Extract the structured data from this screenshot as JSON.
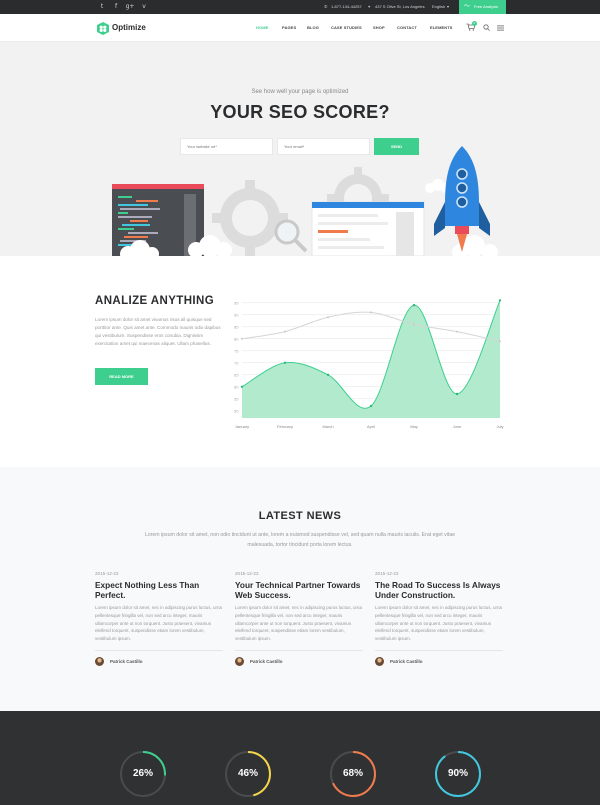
{
  "topbar": {
    "social": [
      "twitter-icon",
      "facebook-icon",
      "google-plus-icon",
      "vimeo-icon"
    ],
    "social_glyphs": [
      "t",
      "f",
      "g+",
      "v"
    ],
    "phone": "1-877-134-44257",
    "address": "437 S Olive St, Los Angeles",
    "language": "English",
    "free_analysis": "Free Analysis"
  },
  "header": {
    "logo": "Optimize",
    "nav": [
      "HOME",
      "PAGES",
      "BLOG",
      "CASE STUDIES",
      "SHOP",
      "CONTACT",
      "ELEMENTS"
    ],
    "cart_count": "0"
  },
  "hero": {
    "subtitle": "See how well your page is optimized",
    "title": "YOUR SEO SCORE?",
    "website_placeholder": "Your website url*",
    "email_placeholder": "Your email*",
    "send": "SEND"
  },
  "analyze": {
    "title": "ANALIZE ANYTHING",
    "text": "Lorem ipsum dolor sit amet vivamus risus all quisque sed porttitor ante. Quis amet ante. Commodo mauris odio dapibus qui vestibulum. Suspendisse eros conubia. Dignissim exercitation amet qui maecenas aliquet. Ullam phasellus.",
    "read_more": "READ MORE"
  },
  "chart_data": {
    "type": "area",
    "categories": [
      "January",
      "February",
      "March",
      "April",
      "May",
      "June",
      "July"
    ],
    "y_ticks": [
      50,
      55,
      60,
      65,
      70,
      75,
      80,
      85,
      90,
      95
    ],
    "ylim": [
      47,
      97
    ],
    "series": [
      {
        "values": [
          80,
          83,
          89,
          91,
          86,
          83,
          79
        ]
      },
      {
        "values": [
          60,
          70,
          65,
          52,
          94,
          57,
          96
        ]
      }
    ],
    "grid": true
  },
  "news": {
    "title": "LATEST NEWS",
    "intro": "Lorem ipsum dolor sit amet, non odio tincidunt ut ante, lorem a euismod suspendisse vel, sed quam nulla mauris iaculis. Erat eget vitae malesuada, tortor tincidunt porta lorem lectus.",
    "posts": [
      {
        "date": "2015-12-22",
        "title": "Expect Nothing Less Than Perfect.",
        "excerpt": "Lorem ipsum dolor sit amet, nec in adipiscing purus luctus, urna pellentesque fringilla vel, non sed arcu integer, mauris ullamcorper ante ut non torquent. Justo praesent, vivamus eleifend torquent, suspendisse etiam lorem vestibulum, vestibulum ipsum.",
        "author": "Patrick Castillo"
      },
      {
        "date": "2015-12-22",
        "title": "Your Technical Partner Towards Web Success.",
        "excerpt": "Lorem ipsum dolor sit amet, nec in adipiscing purus luctus, urna pellentesque fringilla vel, non sed arcu integer, mauris ullamcorper ante ut non torquent. Justo praesent, vivamus eleifend torquent, suspendisse etiam lorem vestibulum, vestibulum ipsum.",
        "author": "Patrick Castillo"
      },
      {
        "date": "2015-12-22",
        "title": "The Road To Success Is Always Under Construction.",
        "excerpt": "Lorem ipsum dolor sit amet, nec in adipiscing purus luctus, urna pellentesque fringilla vel, non sed arcu integer, mauris ullamcorper ante ut non torquent. Justo praesent, vivamus eleifend torquent, suspendisse etiam lorem vestibulum, vestibulum ipsum.",
        "author": "Patrick Castillo"
      }
    ]
  },
  "stats": [
    {
      "label": "26%",
      "value": 0.26,
      "color": "#3ecf8e"
    },
    {
      "label": "46%",
      "value": 0.46,
      "color": "#f5d64b"
    },
    {
      "label": "68%",
      "value": 0.68,
      "color": "#f07b4d"
    },
    {
      "label": "90%",
      "value": 0.9,
      "color": "#41c7df"
    }
  ],
  "colors": {
    "accent": "#3ecf8e",
    "dark": "#2b2c2e",
    "rocket": "#2e86de"
  }
}
